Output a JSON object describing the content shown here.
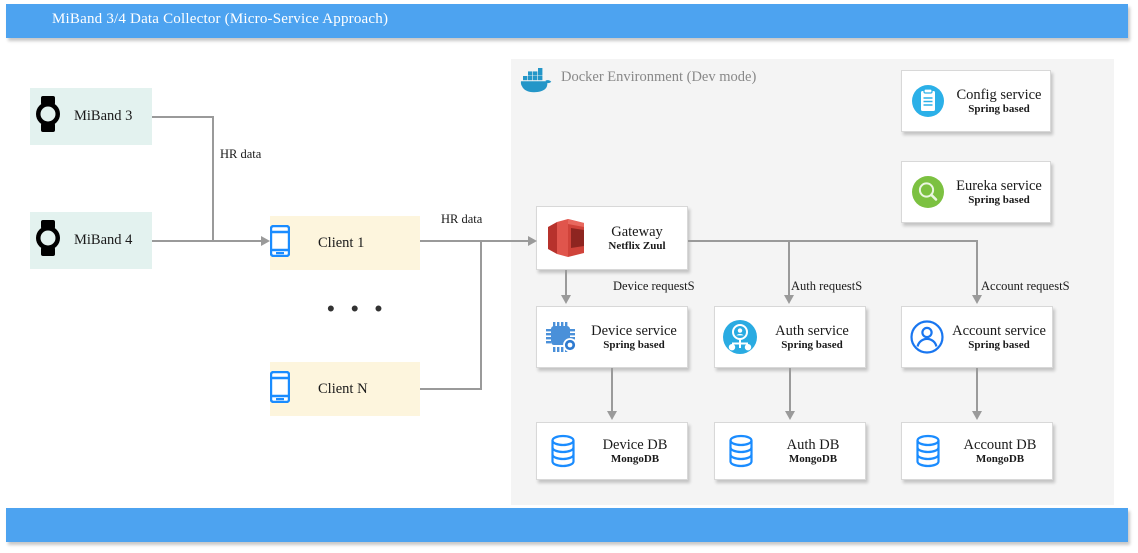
{
  "app": {
    "title": "MiBand 3/4 Data Collector (Micro-Service Approach)",
    "accent_color": "#4da3f0",
    "bottom_bar_color": "#4da3f0"
  },
  "docker": {
    "label": "Docker Environment (Dev mode)",
    "icon": "docker-whale-icon",
    "region_color": "#f4f4f4"
  },
  "devices": [
    {
      "id": "miband3",
      "label": "MiBand 3",
      "icon": "smartwatch-icon",
      "bg": "#e3f2ef"
    },
    {
      "id": "miband4",
      "label": "MiBand 4",
      "icon": "smartwatch-icon",
      "bg": "#e3f2ef"
    }
  ],
  "clients": [
    {
      "id": "client1",
      "label": "Client 1",
      "icon": "smartphone-icon",
      "bg": "#fdf5dd"
    },
    {
      "id": "clientn",
      "label": "Client N",
      "icon": "smartphone-icon",
      "bg": "#fdf5dd"
    }
  ],
  "ellipsis": "• • •",
  "gateway": {
    "title": "Gateway",
    "subtitle": "Netflix Zuul",
    "icon": "aws-gateway-icon",
    "icon_color": "#d0433a"
  },
  "platform_services": [
    {
      "id": "config",
      "title": "Config service",
      "subtitle": "Spring based",
      "icon": "clipboard-icon",
      "icon_color": "#2bb0e8"
    },
    {
      "id": "eureka",
      "title": "Eureka service",
      "subtitle": "Spring based",
      "icon": "magnifier-icon",
      "icon_color": "#7cc141"
    }
  ],
  "microservices": [
    {
      "id": "device",
      "title": "Device service",
      "subtitle": "Spring based",
      "icon": "chip-icon",
      "icon_color": "#4a90d9",
      "request_label": "Device requestS"
    },
    {
      "id": "auth",
      "title": "Auth service",
      "subtitle": "Spring based",
      "icon": "auth-user-icon",
      "icon_color": "#29abe2",
      "request_label": "Auth requestS"
    },
    {
      "id": "account",
      "title": "Account service",
      "subtitle": "Spring based",
      "icon": "account-user-icon",
      "icon_color": "#1976f0",
      "request_label": "Account requestS"
    }
  ],
  "databases": [
    {
      "id": "devicedb",
      "title": "Device DB",
      "subtitle": "MongoDB",
      "icon": "database-icon",
      "icon_color": "#1a8cff"
    },
    {
      "id": "authdb",
      "title": "Auth DB",
      "subtitle": "MongoDB",
      "icon": "database-icon",
      "icon_color": "#1a8cff"
    },
    {
      "id": "accountdb",
      "title": "Account DB",
      "subtitle": "MongoDB",
      "icon": "database-icon",
      "icon_color": "#1a8cff"
    }
  ],
  "edges": {
    "hr_data_band": "HR data",
    "hr_data_client": "HR data"
  }
}
